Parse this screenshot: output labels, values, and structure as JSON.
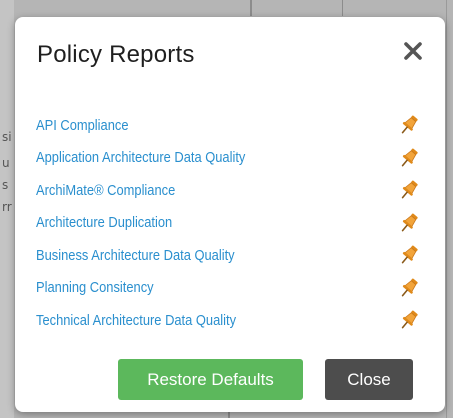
{
  "dialog": {
    "title": "Policy Reports",
    "close_icon": "close-icon"
  },
  "reports": [
    {
      "label": "API Compliance",
      "icon": "pin-icon"
    },
    {
      "label": "Application Architecture Data Quality",
      "icon": "pin-icon"
    },
    {
      "label": "ArchiMate® Compliance",
      "icon": "pin-icon"
    },
    {
      "label": "Architecture Duplication",
      "icon": "pin-icon"
    },
    {
      "label": "Business Architecture Data Quality",
      "icon": "pin-icon"
    },
    {
      "label": "Planning Consitency",
      "icon": "pin-icon"
    },
    {
      "label": "Technical Architecture Data Quality",
      "icon": "pin-icon"
    }
  ],
  "footer": {
    "restore_label": "Restore Defaults",
    "close_label": "Close"
  },
  "colors": {
    "link": "#2a8fce",
    "restore_button": "#5cb85c",
    "close_button": "#4d4d4d",
    "pin": "#f0a030"
  },
  "background": {
    "fragments": [
      "si",
      "u",
      "s",
      "rr"
    ]
  }
}
